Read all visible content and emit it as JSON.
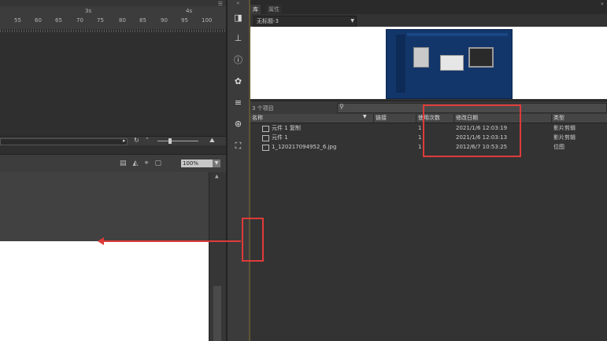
{
  "timeline": {
    "second_labels": [
      "3s",
      "4s"
    ],
    "frame_numbers": [
      "55",
      "60",
      "65",
      "70",
      "75",
      "80",
      "85",
      "90",
      "95",
      "100"
    ],
    "menu_icon": "hamburger-icon"
  },
  "stage": {
    "tools": [
      "stage-camera-icon",
      "stage-clip-icon",
      "center-icon",
      "frame-icon"
    ],
    "zoom": "100%"
  },
  "library": {
    "tabs": [
      "库",
      "属性"
    ],
    "document": "无标题-3",
    "item_count": "3 个项目",
    "columns": [
      "名称",
      "链接",
      "使用次数",
      "修改日期",
      "类型"
    ],
    "rows": [
      {
        "name": "元件 1 复制",
        "link": "",
        "uses": "1",
        "date": "2021/1/6 12:03:19",
        "type": "影片剪辑",
        "icon": "movieclip-icon"
      },
      {
        "name": "元件 1",
        "link": "",
        "uses": "1",
        "date": "2021/1/6 12:03:13",
        "type": "影片剪辑",
        "icon": "movieclip-icon"
      },
      {
        "name": "1_120217094952_6.jpg",
        "link": "",
        "uses": "1",
        "date": "2012/6/7 10:53:25",
        "type": "位图",
        "icon": "bitmap-icon"
      }
    ]
  },
  "colors": {
    "annotation": "#e03a3a",
    "preview_bg": "#12366a"
  }
}
